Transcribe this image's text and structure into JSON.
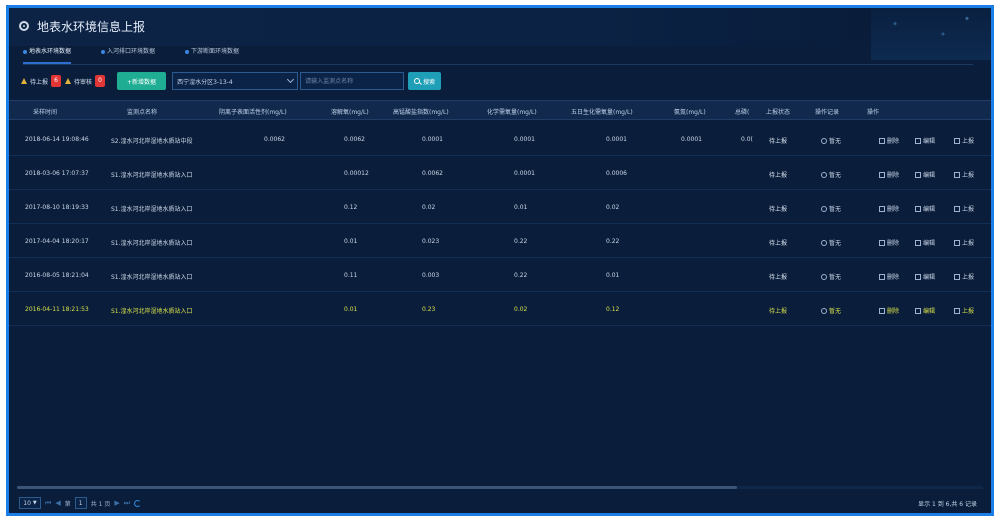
{
  "window": {
    "title": "地表水环境信息上报"
  },
  "tabs": [
    {
      "label": "地表水环境数据",
      "active": true
    },
    {
      "label": "入河排口环境数据",
      "active": false
    },
    {
      "label": "下游断面环境数据",
      "active": false
    }
  ],
  "toolbar": {
    "pending_label": "待上报",
    "pending_count": "6",
    "review_label": "待审核",
    "review_count": "0",
    "add_label": "+新增数据",
    "site_select": "西宁湟水分区3-13-4",
    "search_placeholder": "请输入监测点名称",
    "search_label": "搜索"
  },
  "table": {
    "headers": [
      "采样时间",
      "监测点名称",
      "阴离子表面活性剂(mg/L)",
      "溶解氧(mg/L)",
      "高锰酸盐指数(mg/L)",
      "化学需氧量(mg/L)",
      "五日生化需氧量(mg/L)",
      "氨氮(mg/L)",
      "总磷(",
      "上报状态",
      "操作记录",
      "操作"
    ],
    "rows": [
      {
        "time": "2018-06-14 19:08:46",
        "site": "S2.湟水河北岸湿地水质站中段",
        "v1": "0.0062",
        "v2": "0.0062",
        "v3": "0.0001",
        "v4": "0.0001",
        "v5": "0.0001",
        "v6": "0.0001",
        "v7": "0.0(",
        "status": "待上报",
        "record": "暂无",
        "del": "删除",
        "edit": "编辑",
        "up": "上报"
      },
      {
        "time": "2018-03-06 17:07:37",
        "site": "S1.湟水河北岸湿地水质站入口",
        "v1": "",
        "v2": "0.00012",
        "v3": "0.0062",
        "v4": "0.0001",
        "v5": "0.0006",
        "v6": "",
        "v7": "",
        "status": "待上报",
        "record": "暂无",
        "del": "删除",
        "edit": "编辑",
        "up": "上报"
      },
      {
        "time": "2017-08-10 18:19:33",
        "site": "S1.湟水河北岸湿地水质站入口",
        "v1": "",
        "v2": "0.12",
        "v3": "0.02",
        "v4": "0.01",
        "v5": "0.02",
        "v6": "",
        "v7": "",
        "status": "待上报",
        "record": "暂无",
        "del": "删除",
        "edit": "编辑",
        "up": "上报"
      },
      {
        "time": "2017-04-04 18:20:17",
        "site": "S1.湟水河北岸湿地水质站入口",
        "v1": "",
        "v2": "0.01",
        "v3": "0.023",
        "v4": "0.22",
        "v5": "0.22",
        "v6": "",
        "v7": "",
        "status": "待上报",
        "record": "暂无",
        "del": "删除",
        "edit": "编辑",
        "up": "上报"
      },
      {
        "time": "2016-08-05 18:21:04",
        "site": "S1.湟水河北岸湿地水质站入口",
        "v1": "",
        "v2": "0.11",
        "v3": "0.003",
        "v4": "0.22",
        "v5": "0.01",
        "v6": "",
        "v7": "",
        "status": "待上报",
        "record": "暂无",
        "del": "删除",
        "edit": "编辑",
        "up": "上报"
      },
      {
        "time": "2016-04-11 18:21:53",
        "site": "S1.湟水河北岸湿地水质站入口",
        "v1": "",
        "v2": "0.01",
        "v3": "0.23",
        "v4": "0.02",
        "v5": "0.12",
        "v6": "",
        "v7": "",
        "status": "待上报",
        "record": "暂无",
        "del": "删除",
        "edit": "编辑",
        "up": "上报"
      }
    ]
  },
  "pager": {
    "page_size": "10",
    "page_prefix": "第",
    "page_current": "1",
    "page_total": "共 1 页",
    "summary": "显示 1 到 6,共 6 记录"
  },
  "colors": {
    "accent": "#1a7ee6",
    "add_button": "#1fae93",
    "search_button": "#1f9fb7",
    "badge": "#e23636",
    "highlight_row": "#d6e04a"
  },
  "icons": [
    "logo-icon",
    "warning-icon",
    "chevron-down-icon",
    "search-icon",
    "history-icon",
    "trash-icon",
    "edit-icon",
    "upload-icon",
    "refresh-icon"
  ]
}
